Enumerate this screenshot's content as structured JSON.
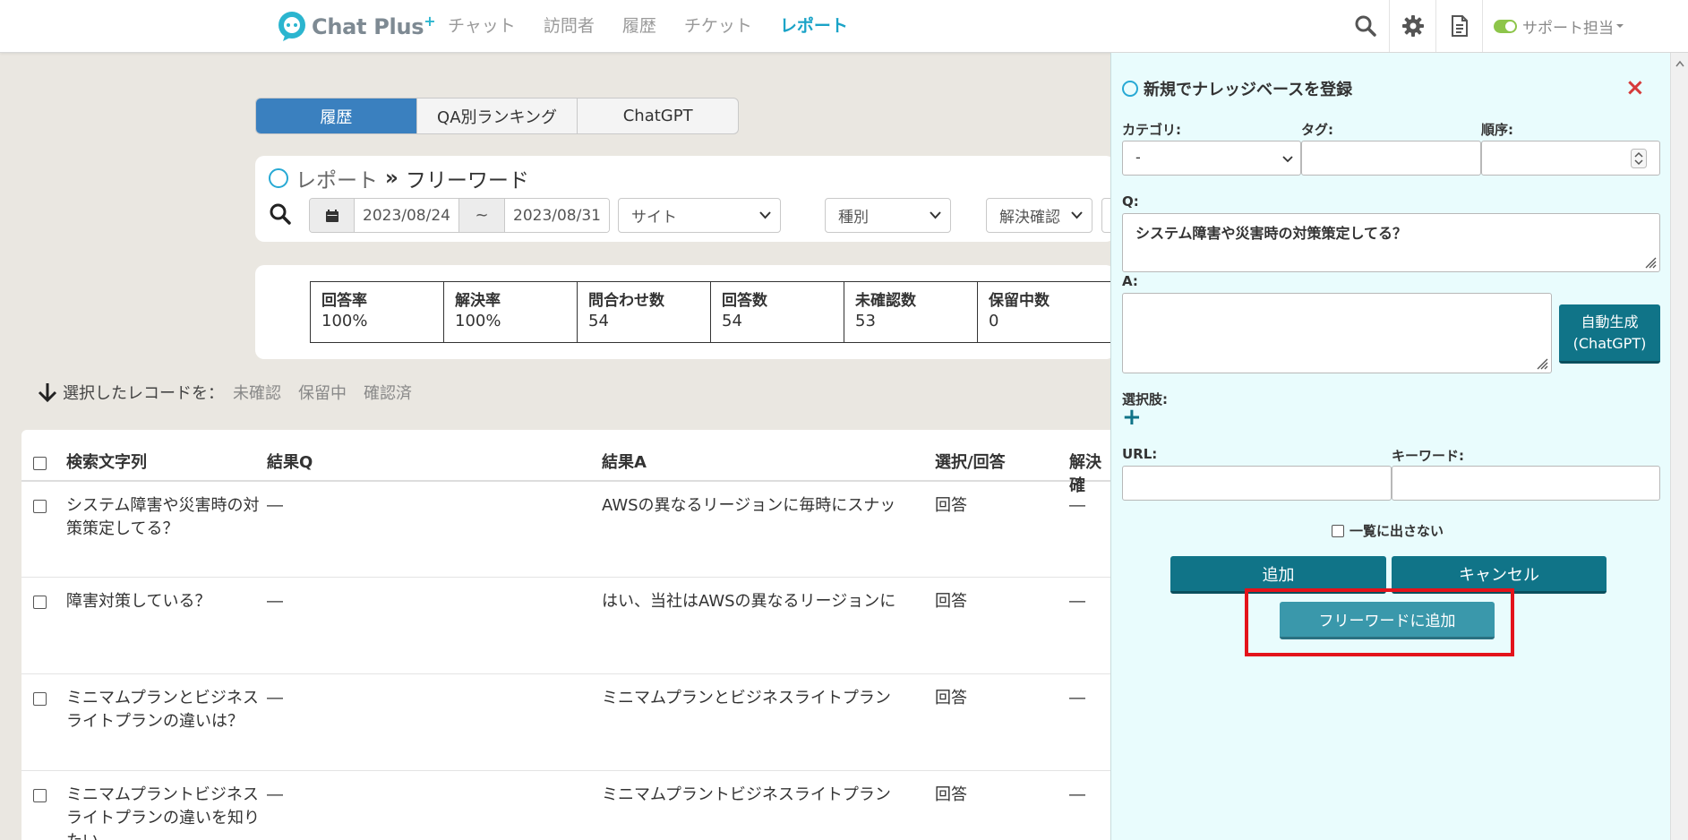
{
  "nav": {
    "logo_text": "Chat Plus",
    "logo_sup": "+",
    "items": [
      {
        "label": "チャット"
      },
      {
        "label": "訪問者"
      },
      {
        "label": "履歴"
      },
      {
        "label": "チケット"
      },
      {
        "label": "レポート",
        "active": true
      }
    ],
    "agent_label": "サポート担当",
    "agent_status": "online"
  },
  "report_tabs": [
    {
      "label": "履歴",
      "active": true
    },
    {
      "label": "QA別ランキング"
    },
    {
      "label": "ChatGPT"
    }
  ],
  "filter": {
    "breadcrumb_parent": "レポート",
    "breadcrumb_sep": "»",
    "breadcrumb_current": "フリーワード",
    "date_from": "2023/08/24",
    "date_sep": "~",
    "date_to": "2023/08/31",
    "site_select": "サイト",
    "type_select": "種別",
    "resolve_select": "解決確認"
  },
  "stats": [
    {
      "label": "回答率",
      "value": "100%"
    },
    {
      "label": "解決率",
      "value": "100%"
    },
    {
      "label": "問合わせ数",
      "value": "54"
    },
    {
      "label": "回答数",
      "value": "54"
    },
    {
      "label": "未確認数",
      "value": "53"
    },
    {
      "label": "保留中数",
      "value": "0"
    }
  ],
  "bulk": {
    "label": "選択したレコードを：",
    "actions": [
      "未確認",
      "保留中",
      "確認済"
    ]
  },
  "table": {
    "headers": {
      "query": "検索文字列",
      "result_q": "結果Q",
      "result_a": "結果A",
      "select_answer": "選択/回答",
      "resolve": "解決確"
    },
    "rows": [
      {
        "query": "システム障害や災害時の対策策定してる？",
        "result_q": "―",
        "result_a": "AWSの異なるリージョンに毎時にスナッ",
        "select_answer": "回答",
        "resolve": "―"
      },
      {
        "query": "障害対策している？",
        "result_q": "―",
        "result_a": "はい、当社はAWSの異なるリージョンに",
        "select_answer": "回答",
        "resolve": "―"
      },
      {
        "query": "ミニマムプランとビジネスライトプランの違いは？",
        "result_q": "―",
        "result_a": "ミニマムプランとビジネスライトプラン",
        "select_answer": "回答",
        "resolve": "―"
      },
      {
        "query": "ミニマムプラントビジネスライトプランの違いを知りたい",
        "result_q": "―",
        "result_a": "ミニマムプラントビジネスライトプラン",
        "select_answer": "回答",
        "resolve": "―"
      }
    ]
  },
  "panel": {
    "title": "新規でナレッジベースを登録",
    "close_glyph": "×",
    "category_label": "カテゴリ:",
    "category_value": "-",
    "tag_label": "タグ:",
    "tag_value": "",
    "order_label": "順序:",
    "order_value": "",
    "q_label": "Q:",
    "q_value": "システム障害や災害時の対策策定してる？",
    "a_label": "A:",
    "a_value": "",
    "autogen_label_1": "自動生成",
    "autogen_label_2": "(ChatGPT)",
    "choices_label": "選択肢:",
    "add_choice_glyph": "+",
    "url_label": "URL:",
    "url_value": "",
    "keyword_label": "キーワード:",
    "keyword_value": "",
    "hide_list_label": "一覧に出さない",
    "hide_list_checked": false,
    "add_button": "追加",
    "cancel_button": "キャンセル",
    "freeword_button": "フリーワードに追加"
  },
  "colors": {
    "accent": "#1aa3c7",
    "tab_active": "#3a80bf",
    "panel_bg": "#e9fcfd",
    "button_teal": "#107488",
    "highlight_border": "#e3131b"
  }
}
